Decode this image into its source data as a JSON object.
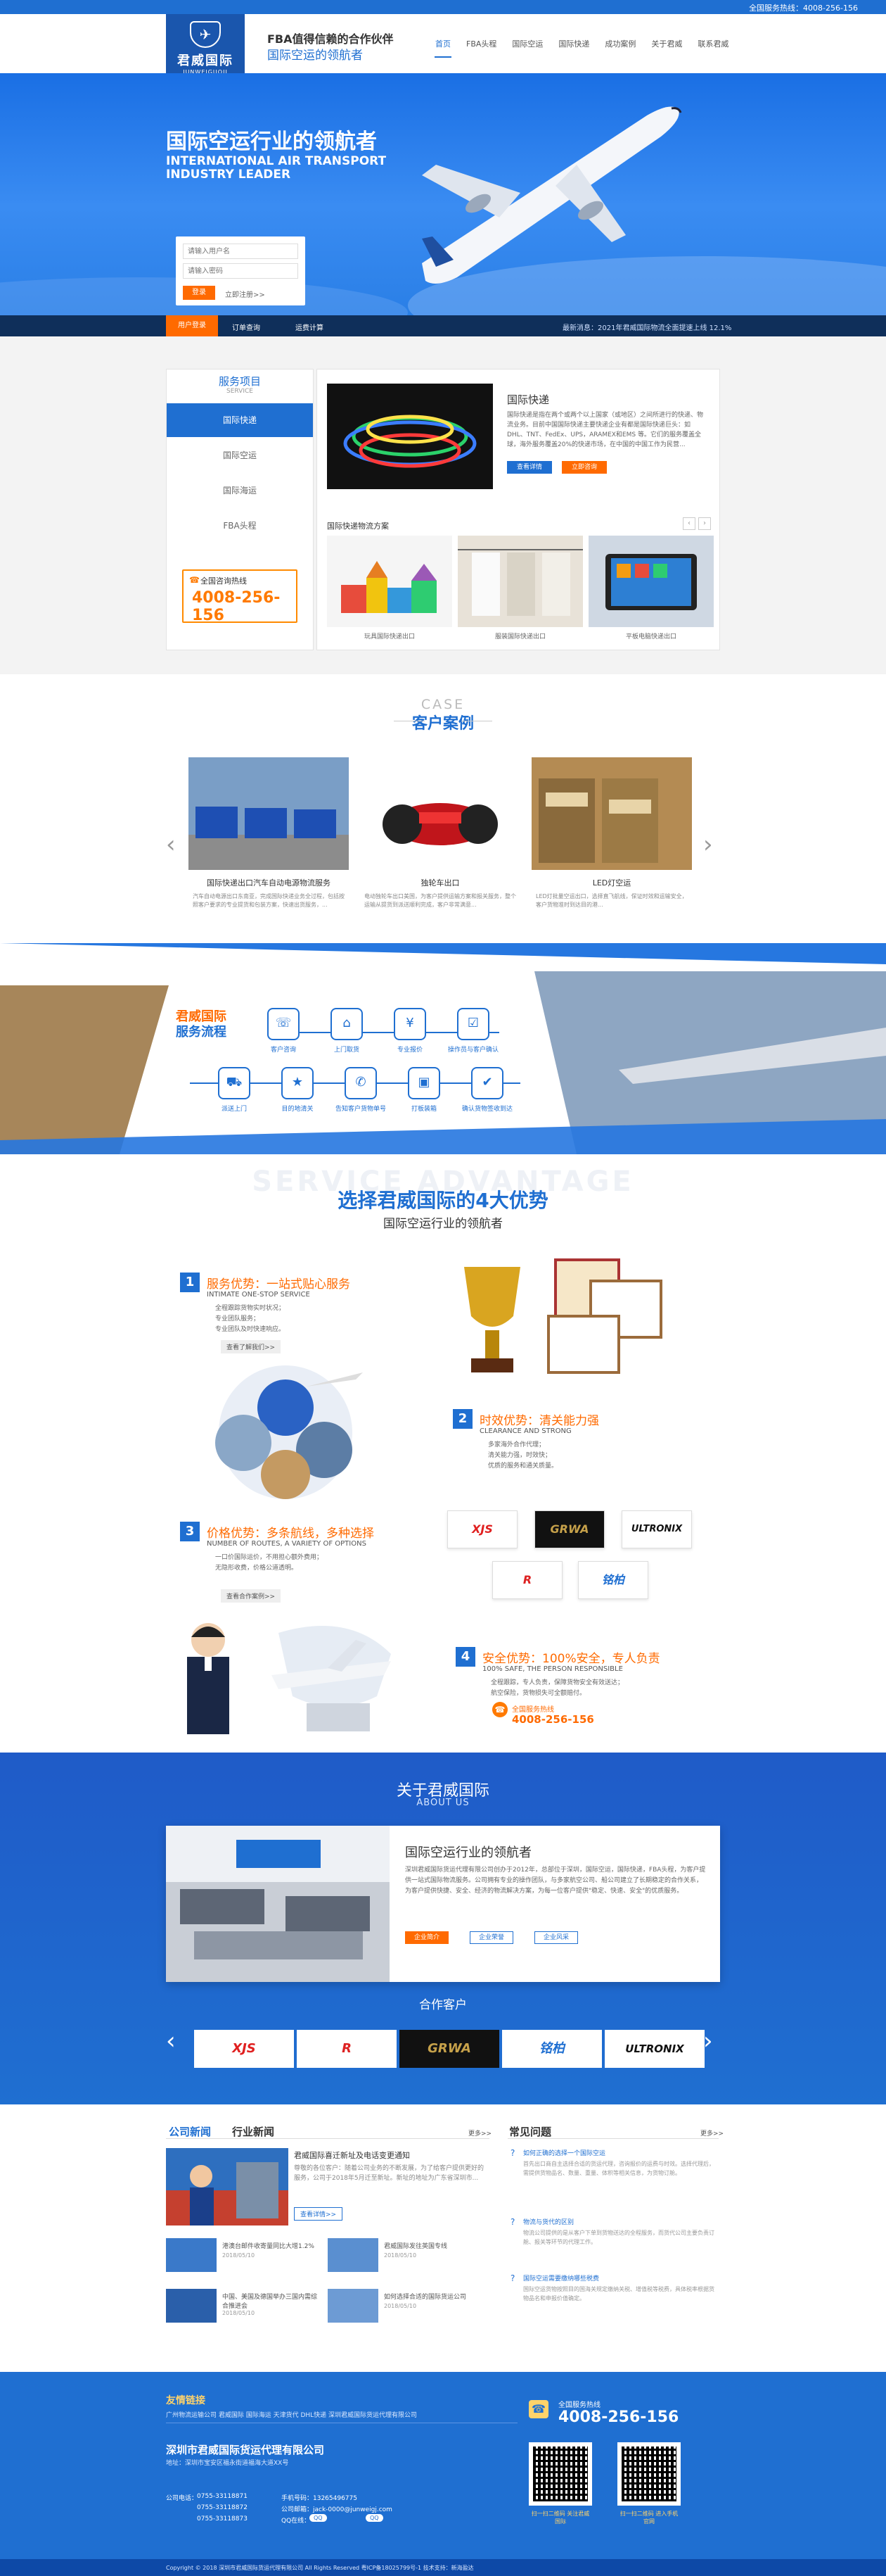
{
  "topbar": {
    "hotline": "全国服务热线：4008-256-156"
  },
  "header": {
    "logo": {
      "name": "君威国际",
      "en": "JUNWEIGUOJI"
    },
    "slogan_line1": "FBA值得信赖的合作伙伴",
    "slogan_line2": "国际空运的领航者",
    "nav": [
      "首页",
      "FBA头程",
      "国际空运",
      "国际快递",
      "成功案例",
      "关于君威",
      "联系君威"
    ]
  },
  "banner": {
    "title": "国际空运行业的领航者",
    "subtitle_en": "INTERNATIONAL AIR TRANSPORT\nINDUSTRY LEADER",
    "form": {
      "ph1": "请输入用户名",
      "ph2": "请输入密码",
      "login": "登录",
      "register": "立即注册>>"
    }
  },
  "quickbar": {
    "items": [
      "用户登录",
      "订单查询",
      "运费计算"
    ],
    "announcement": "最新消息：2021年君威国际物流全面提速上线 12.1%"
  },
  "services": {
    "title": "服务项目",
    "title_en": "SERVICE",
    "tabs": [
      "国际快递",
      "国际空运",
      "国际海运",
      "FBA头程"
    ],
    "hotline_label": "全国咨询热线",
    "hotline": "4008-256-156",
    "feature_title": "国际快递",
    "feature_desc": "国际快递是指在两个或两个以上国家（或地区）之间所进行的快递、物流业务。目前中国国际快递主要快递企业有都是国际快递巨头：如 DHL、TNT、FedEx、UPS，ARAMEX和EMS 等。它们的服务覆盖全球，海外服务覆盖20%的快递市场，在中国的中国工作为民营...",
    "feature_btn1": "查看详情",
    "feature_btn2": "立即咨询",
    "sub_title": "国际快递物流方案",
    "thumbs": [
      "玩具国际快递出口",
      "服装国际快递出口",
      "平板电脑快递出口"
    ]
  },
  "cases": {
    "title_en": "CASE",
    "title": "客户案例",
    "items": [
      {
        "title": "国际快递出口汽车自动电源物流服务",
        "desc": "汽车自动电源出口东南亚，完成国际快递业务全过程，包括按照客户要求的专业提货和包装方案，快速出货服务，..."
      },
      {
        "title": "独轮车出口",
        "desc": "电动独轮车出口美国，为客户提供运输方案和报关服务，整个运输从提货到派送顺利完成，客户非常满意..."
      },
      {
        "title": "LED灯空运",
        "desc": "LED灯批量空运出口，选择直飞航线，保证时效和运输安全，客户货物准时到达目的港..."
      }
    ]
  },
  "process": {
    "brand": "君威国际",
    "title": "服务流程",
    "top_steps": [
      "客户咨询",
      "上门取货",
      "专业报价",
      "操作员与客户确认"
    ],
    "bottom_steps": [
      "派送上门",
      "目的地清关",
      "告知客户货物单号",
      "打板装箱",
      "确认货物签收到达"
    ]
  },
  "advantages": {
    "bg_text": "SERVICE ADVANTAGE",
    "title": "选择君威国际的4大优势",
    "subtitle": "国际空运行业的领航者",
    "items": [
      {
        "num": "1",
        "title": "服务优势：一站式贴心服务",
        "en": "INTIMATE ONE-STOP SERVICE",
        "lines": [
          "全程跟踪货物实时状况；",
          "专业团队服务；",
          "专业团队及时快速响应。"
        ],
        "btn": "查看了解我们>>"
      },
      {
        "num": "2",
        "title": "时效优势：清关能力强",
        "en": "CLEARANCE AND STRONG",
        "lines": [
          "多家海外合作代理；",
          "清关能力强，时效快；",
          "优质的服务和通关质量。"
        ]
      },
      {
        "num": "3",
        "title": "价格优势：多条航线，多种选择",
        "en": "NUMBER OF ROUTES, A VARIETY OF OPTIONS",
        "lines": [
          "一口价国际运价，不用担心额外费用；",
          "无隐形收费，价格公道透明。"
        ],
        "btn": "查看合作案例>>"
      },
      {
        "num": "4",
        "title": "安全优势：100%安全，专人负责",
        "en": "100% SAFE, THE PERSON RESPONSIBLE",
        "lines": [
          "全程跟踪，专人负责，保障货物安全有效送达；",
          "航空保险，货物损失可全额赔付。"
        ]
      }
    ],
    "hotline_label": "全国服务热线",
    "hotline": "4008-256-156",
    "brands": [
      "XJS",
      "GRWA",
      "ULTRONIX",
      "R",
      "铭柏"
    ]
  },
  "about": {
    "title": "关于君威国际",
    "title_en": "ABOUT US",
    "heading": "国际空运行业的领航者",
    "text": "深圳君威国际货运代理有限公司创办于2012年，总部位于深圳，国际空运，国际快递，FBA头程，为客户提供一站式国际物流服务。公司拥有专业的操作团队，与多家航空公司、船公司建立了长期稳定的合作关系，为客户提供快捷、安全、经济的物流解决方案，为每一位客户提供\"稳定、快速、安全\"的优质服务。",
    "btns": [
      "企业简介",
      "企业荣誉",
      "企业风采"
    ],
    "partners_title": "合作客户",
    "partners": [
      "XJS",
      "R",
      "GRWA",
      "铭柏",
      "ULTRONIX"
    ]
  },
  "news": {
    "tabs": [
      "公司新闻",
      "行业新闻"
    ],
    "more": "更多>>",
    "lead": {
      "title": "君威国际喜迁新址及电话变更通知",
      "desc": "尊敬的各位客户：随着公司业务的不断发展，为了给客户提供更好的服务，公司于2018年5月迁至新址。新址的地址为广东省深圳市...",
      "btn": "查看详情>>"
    },
    "list": [
      {
        "title": "港澳台邮件收寄量同比大增1.2%",
        "date": "2018/05/10"
      },
      {
        "title": "君威国际发往英国专线",
        "date": "2018/05/10"
      },
      {
        "title": "中国、美国及德国举办三国内需综合推进会",
        "date": "2018/05/10"
      },
      {
        "title": "如何选择合适的国际货运公司",
        "date": "2018/05/10"
      }
    ],
    "faq_title": "常见问题",
    "faqs": [
      {
        "q": "如何正确的选择一个国际空运",
        "a": "首先出口商自主选择合适的货运代理，咨询报价的运费与时效。选择代理后，需提供货物品名、数量、重量、体积等相关信息，为货物订舱。"
      },
      {
        "q": "物流与货代的区别",
        "a": "物流公司提供的是从客户下单到货物送达的全程服务，而货代公司主要负责订舱、报关等环节的代理工作。"
      },
      {
        "q": "国际空运需要缴纳哪些税费",
        "a": "国际空运货物按照目的国海关规定缴纳关税、增值税等税费，具体税率根据货物品名和申报价值确定。"
      }
    ]
  },
  "footer": {
    "links_title": "友情链接",
    "links": "广州物流运输公司 君威国际 国际海运 天津货代 DHL快递 深圳君威国际货运代理有限公司",
    "company": "深圳市君威国际货运代理有限公司",
    "address": "地址：深圳市宝安区福永街道福海大道XX号",
    "phones": [
      "公司电话：",
      "0755-33118871",
      "0755-33118872",
      "0755-33118873"
    ],
    "mobile": "手机号码：13265496775",
    "email": "公司邮箱：jack-0000@junweigj.com",
    "qq": "QQ在线：",
    "hotline_label": "全国服务热线",
    "hotline": "4008-256-156",
    "qr1": "扫一扫二维码 关注君威国际",
    "qr2": "扫一扫二维码 进入手机官网",
    "copyright": "Copyright © 2018 深圳市君威国际货运代理有限公司 All Rights Reserved   粤ICP备18025799号-1   技术支持：新海盈达"
  }
}
